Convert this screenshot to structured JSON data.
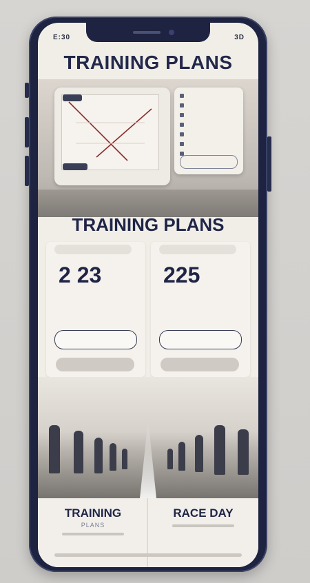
{
  "status_bar": {
    "left": "E:30",
    "right": "3D"
  },
  "header": {
    "title": "TRAINING PLANS"
  },
  "hero": {
    "map_button_top": "",
    "map_button_bottom": "",
    "panel_rows": [
      "",
      "",
      "",
      "",
      "",
      "",
      "",
      "",
      ""
    ],
    "panel_button": ""
  },
  "section": {
    "title": "TRAINING PLANS"
  },
  "plans": [
    {
      "tag": "",
      "value": "2 23",
      "unit": "",
      "description": "",
      "cta": "",
      "pill": ""
    },
    {
      "tag": "",
      "value": "225",
      "unit": "",
      "description": "",
      "cta": "",
      "pill": ""
    }
  ],
  "bottom_tabs": [
    {
      "label": "TRAINING",
      "sub": "PLANS"
    },
    {
      "label": "RACE DAY",
      "sub": ""
    }
  ],
  "colors": {
    "primary": "#1f2547",
    "frame": "#1d2340",
    "screen_bg": "#f1eee8"
  }
}
